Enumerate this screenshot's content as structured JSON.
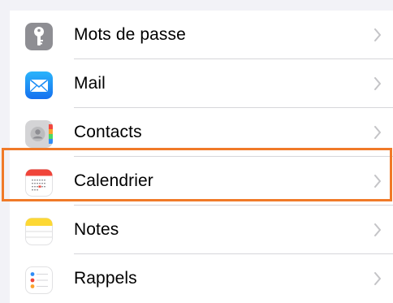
{
  "settings_list": {
    "items": [
      {
        "label": "Mots de passe",
        "icon": "key-icon",
        "icon_color": "#8e8e93"
      },
      {
        "label": "Mail",
        "icon": "mail-icon",
        "icon_color": "#1a8cf6"
      },
      {
        "label": "Contacts",
        "icon": "contacts-icon",
        "icon_color": "#cfcfcf"
      },
      {
        "label": "Calendrier",
        "icon": "calendar-icon",
        "icon_color": "#ffffff"
      },
      {
        "label": "Notes",
        "icon": "notes-icon",
        "icon_color": "#fdd834"
      },
      {
        "label": "Rappels",
        "icon": "reminders-icon",
        "icon_color": "#ffffff"
      }
    ]
  },
  "highlight": {
    "target": "Calendrier",
    "color": "#f07a28"
  },
  "colors": {
    "background": "#f2f2f7",
    "separator": "#d6d6da",
    "chevron": "#c4c4c7"
  }
}
